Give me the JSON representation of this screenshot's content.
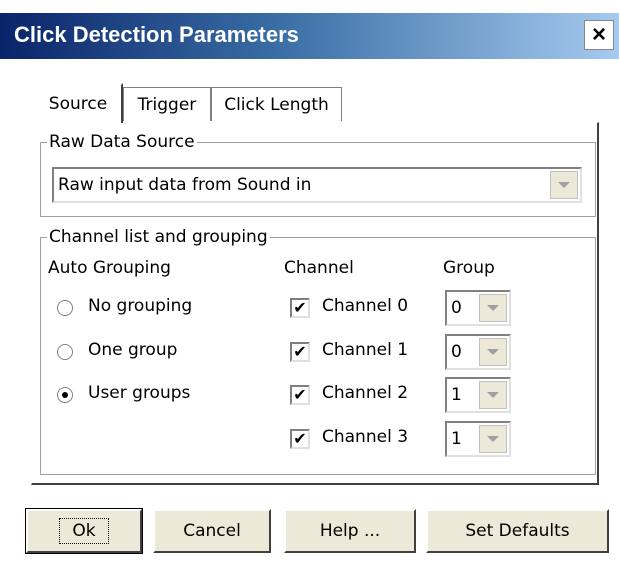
{
  "window": {
    "title": "Click Detection Parameters",
    "close_label": "×"
  },
  "tabs": [
    {
      "label": "Source",
      "active": true
    },
    {
      "label": "Trigger",
      "active": false
    },
    {
      "label": "Click Length",
      "active": false
    }
  ],
  "raw_source": {
    "legend": "Raw Data Source",
    "selected": "Raw input data from Sound in"
  },
  "channels": {
    "legend": "Channel list and grouping",
    "auto_grouping_header": "Auto Grouping",
    "channel_header": "Channel",
    "group_header": "Group",
    "grouping_options": [
      {
        "label": "No grouping",
        "selected": false
      },
      {
        "label": "One group",
        "selected": false
      },
      {
        "label": "User groups",
        "selected": true
      }
    ],
    "rows": [
      {
        "label": "Channel 0",
        "checked": true,
        "group": "0"
      },
      {
        "label": "Channel 1",
        "checked": true,
        "group": "0"
      },
      {
        "label": "Channel 2",
        "checked": true,
        "group": "1"
      },
      {
        "label": "Channel 3",
        "checked": true,
        "group": "1"
      }
    ]
  },
  "buttons": {
    "ok": "Ok",
    "cancel": "Cancel",
    "help": "Help ...",
    "defaults": "Set Defaults"
  },
  "check_glyph": "✔"
}
